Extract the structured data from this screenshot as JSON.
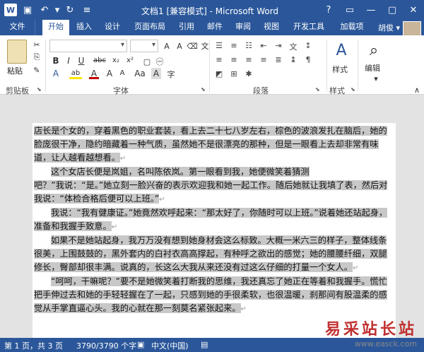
{
  "title_bar": {
    "title": "文档1 [兼容模式] - Microsoft Word",
    "window_controls": [
      "?",
      "▭",
      "—",
      "▢",
      "✕"
    ]
  },
  "tabs": {
    "file": "文件",
    "items": [
      "开始",
      "插入",
      "设计",
      "页面布局",
      "引用",
      "邮件",
      "审阅",
      "视图",
      "开发工具",
      "加载项"
    ],
    "active_index": 0,
    "user": "胡俊 ▾"
  },
  "ribbon": {
    "paste": "粘贴",
    "group_clipboard": "剪贴板",
    "group_font": "字体",
    "group_paragraph": "段落",
    "group_styles": "样式",
    "styles_button": "样式",
    "edit_button": "编辑",
    "font_buttons": [
      "B",
      "I",
      "U",
      "abc",
      "x₂",
      "x²"
    ],
    "font_row3": [
      "A",
      "ab",
      "A",
      "A",
      "A",
      "Aa",
      "A"
    ]
  },
  "document": {
    "paragraphs": [
      "店长是个女的，穿着黑色的职业套装，看上去二十七八岁左右，棕色的波浪发扎在脑后，她的脸庞很干净，隐约暗藏着一种气质，虽然她不是很漂亮的那种，但是一眼看上去却非常有味道，让人越看越想看。",
      "这个女店长便是岚姐，名叫陈依岚。第一眼看到我，她便微笑着猜测",
      "吧？”我说：“是。”她立刻一脸兴奋的表示欢迎我和她一起工作。随后她就让我填了表，然后对我说：“体检合格后便可以上班。”",
      "我说：“我有健康证。”她竟然欢呼起来：“那太好了，你随时可以上班。”说着她还站起身，准备和我握手致意。",
      "如果不是她站起身，我万万没有想到她身材会这么标致。大概一米六三的样子，整体线条很美，上围鼓鼓的，黑外套内的白衬衣高高撑起，有种呼之欲出的感觉；她的腰腰纤细，双腿修长，臀部却很丰满。说真的，长这么大我从来还没有过这么仔细的打量一个女人。",
      "“呵呵，干嘛呢？”要不是她微笑着打断我的思维，我还真忘了她正在等着和我握手。慌忙把手伸过去和她的手轻轻握在了一起，只感到她的手很柔软，也很温暖，刹那间有股温柔的感觉从手掌直逼心头。我的心就在那一刻莫名紧张起来。"
    ]
  },
  "status_bar": {
    "page": "第 1 页，共 3 页",
    "words": "3790/3790 个字",
    "language": "中文(中国)"
  },
  "watermark": {
    "cn": "易采站长站",
    "en": "www.easck.com"
  },
  "colors": {
    "accent": "#2b579a",
    "selection": "#c8c8c8",
    "highlight_border": "#d00000"
  }
}
